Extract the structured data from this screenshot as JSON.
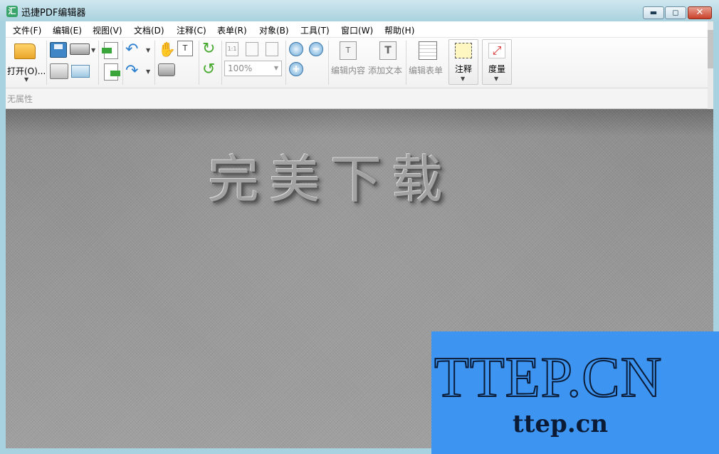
{
  "window": {
    "title": "迅捷PDF编辑器",
    "app_icon_glyph": "汇",
    "controls": {
      "minimize": "▬",
      "maximize": "◻",
      "close": "✕"
    }
  },
  "menubar": [
    "文件(F)",
    "编辑(E)",
    "视图(V)",
    "文档(D)",
    "注释(C)",
    "表单(R)",
    "对象(B)",
    "工具(T)",
    "窗口(W)",
    "帮助(H)"
  ],
  "toolbar": {
    "open_label": "打开(O)...",
    "zoom_value": "100%",
    "edit_content_label": "编辑内容",
    "add_text_label": "添加文本",
    "edit_form_label": "编辑表单",
    "annotate_label": "注释",
    "measure_label": "度量",
    "fit_actual": "1:1",
    "icons": [
      "folder-icon",
      "save-icon",
      "scanner-icon",
      "print-icon",
      "email-icon",
      "import-icon",
      "export-icon",
      "undo-icon",
      "redo-icon",
      "hand-icon",
      "select-text-icon",
      "snapshot-icon",
      "rotate-cw-icon",
      "rotate-ccw-icon",
      "actual-size-icon",
      "fit-page-icon",
      "fit-width-icon",
      "zoom-in-icon",
      "zoom-out-icon",
      "zoom-tool-icon",
      "edit-content-icon",
      "add-text-icon",
      "edit-form-icon",
      "annotate-icon",
      "measure-icon"
    ]
  },
  "properties_bar": {
    "label": "无属性"
  },
  "document": {
    "headline": "完美下载"
  },
  "watermark": {
    "title": "TTEP.CN",
    "subtitle": "ttep.cn"
  },
  "colors": {
    "titlebar": "#a9d2df",
    "watermark_bg": "#3d95f1",
    "watermark_ink": "#0b1b36"
  }
}
